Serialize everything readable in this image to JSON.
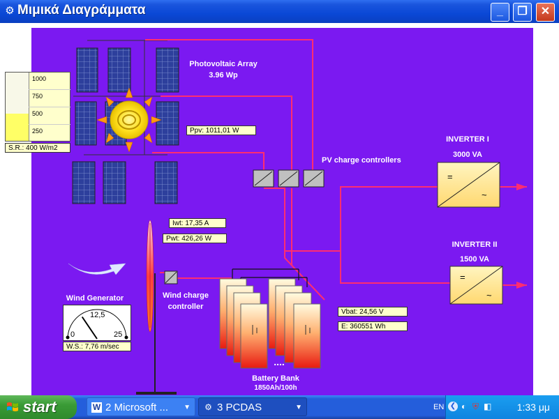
{
  "window": {
    "title": "Μιμικά Διαγράμματα",
    "minimize_glyph": "_",
    "maximize_glyph": "❐",
    "close_glyph": "✕",
    "app_icon": "pcdas-app-icon"
  },
  "pv": {
    "title": "Photovoltaic Array",
    "rating": "3.96 Wp",
    "power": "Ppv: 1011,01 W",
    "controllers_label": "PV charge controllers"
  },
  "solar_gauge": {
    "ticks": [
      "1000",
      "750",
      "500",
      "250"
    ],
    "level_fraction": 0.4,
    "reading": "S.R.: 400 W/m2"
  },
  "wind": {
    "current": "Iwt: 17,35 A",
    "power": "Pwt: 426,26 W",
    "generator_label": "Wind Generator",
    "controller_label": "Wind charge controller",
    "meter_min": "0",
    "meter_mid": "12,5",
    "meter_max": "25",
    "speed_value": 7.76,
    "speed_reading": "W.S.: 7,76 m/sec"
  },
  "inverters": [
    {
      "name": "INVERTER I",
      "rating": "3000 VA"
    },
    {
      "name": "INVERTER II",
      "rating": "1500 VA"
    }
  ],
  "battery": {
    "voltage": "Vbat: 24,56 V",
    "energy": "E: 360551 Wh",
    "label": "Battery Bank",
    "capacity": "1850Ah/100h",
    "ellipsis": "...."
  },
  "colors": {
    "background": "#7b19f1",
    "wire": "#ff2d70",
    "value_box": "#ffffcc",
    "inverter_fill": "#ffe89a"
  },
  "taskbar": {
    "start_label": "start",
    "tasks": [
      {
        "label": "2 Microsoft ...",
        "icon": "word-icon"
      },
      {
        "label": "3 PCDAS",
        "icon": "pcdas-icon"
      }
    ],
    "language": "EN",
    "clock": "1:33 μμ"
  }
}
